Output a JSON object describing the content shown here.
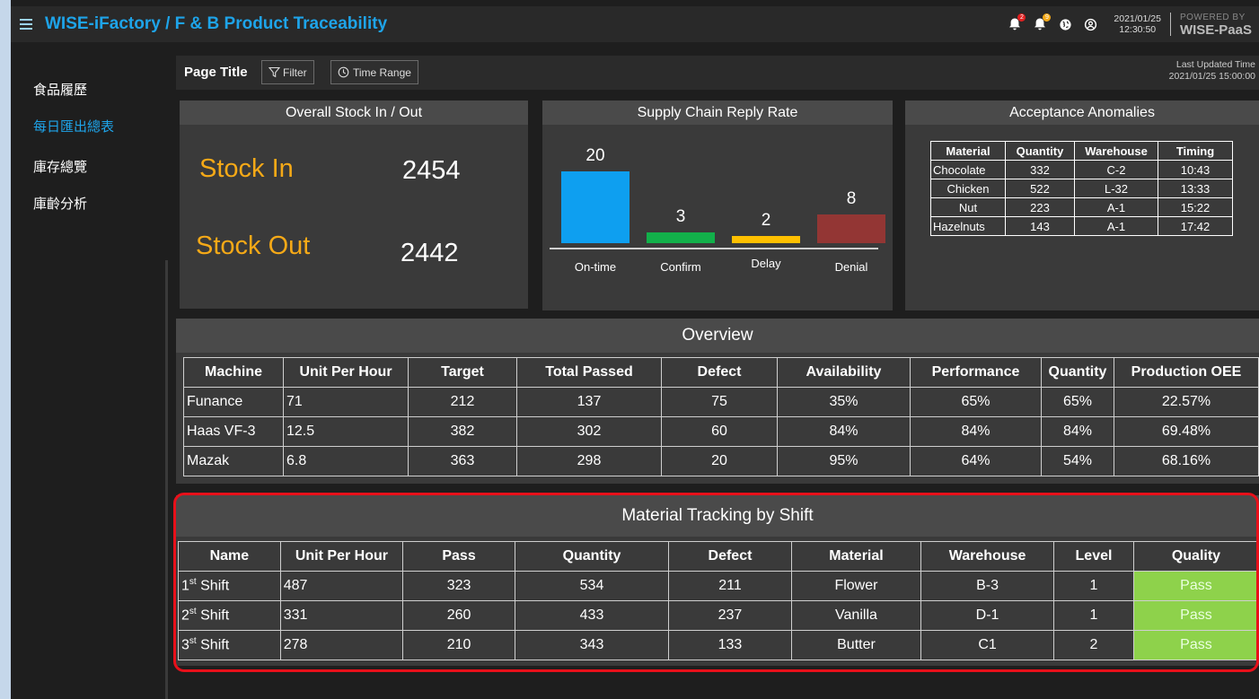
{
  "app": {
    "title": "WISE-iFactory / F & B Product Traceability"
  },
  "header": {
    "notif_badge_1": "2",
    "notif_badge_2": "9",
    "date": "2021/01/25",
    "time": "12:30:50",
    "powered_by_small": "POWERED BY",
    "powered_by_brand": "WISE-PaaS"
  },
  "sidebar": {
    "items": [
      {
        "label": "食品履歷"
      },
      {
        "label": "每日匯出總表"
      },
      {
        "label": "庫存總覽"
      },
      {
        "label": "庫齡分析"
      }
    ]
  },
  "toolbar": {
    "page_title": "Page Title",
    "filter_label": "Filter",
    "time_range_label": "Time Range",
    "last_updated_label": "Last Updated Time",
    "last_updated_value": "2021/01/25 15:00:00"
  },
  "stock": {
    "title": "Overall Stock In / Out",
    "in_label": "Stock In",
    "in_value": "2454",
    "out_label": "Stock Out",
    "out_value": "2442"
  },
  "chart_data": {
    "type": "bar",
    "title": "Supply Chain Reply Rate",
    "categories": [
      "On-time",
      "Confirm",
      "Delay",
      "Denial"
    ],
    "values": [
      20,
      3,
      2,
      8
    ],
    "colors": [
      "#0e9ff0",
      "#12b04a",
      "#ffc000",
      "#933634"
    ],
    "ylim": [
      0,
      20
    ],
    "grid": false
  },
  "anomalies": {
    "title": "Acceptance Anomalies",
    "headers": [
      "Material",
      "Quantity",
      "Warehouse",
      "Timing"
    ],
    "rows": [
      [
        "Chocolate",
        "332",
        "C-2",
        "10:43"
      ],
      [
        "Chicken",
        "522",
        "L-32",
        "13:33"
      ],
      [
        "Nut",
        "223",
        "A-1",
        "15:22"
      ],
      [
        "Hazelnuts",
        "143",
        "A-1",
        "17:42"
      ]
    ]
  },
  "overview": {
    "title": "Overview",
    "headers": [
      "Machine",
      "Unit Per  Hour",
      "Target",
      "Total Passed",
      "Defect",
      "Availability",
      "Performance",
      "Quantity",
      "Production OEE"
    ],
    "rows": [
      [
        "Funance",
        "71",
        "212",
        "137",
        "75",
        "35%",
        "65%",
        "65%",
        "22.57%"
      ],
      [
        "Haas VF-3",
        "12.5",
        "382",
        "302",
        "60",
        "84%",
        "84%",
        "84%",
        "69.48%"
      ],
      [
        "Mazak",
        "6.8",
        "363",
        "298",
        "20",
        "95%",
        "64%",
        "54%",
        "68.16%"
      ]
    ]
  },
  "tracking": {
    "title": "Material Tracking by Shift",
    "headers": [
      "Name",
      "Unit Per  Hour",
      "Pass",
      "Quantity",
      "Defect",
      "Material",
      "Warehouse",
      "Level",
      "Quality"
    ],
    "rows": [
      {
        "num": "1",
        "sup": "st",
        "rest": " Shift",
        "cells": [
          "487",
          "323",
          "534",
          "211",
          "Flower",
          "B-3",
          "1",
          "Pass"
        ]
      },
      {
        "num": "2",
        "sup": "st",
        "rest": " Shift",
        "cells": [
          "331",
          "260",
          "433",
          "237",
          "Vanilla",
          "D-1",
          "1",
          "Pass"
        ]
      },
      {
        "num": "3",
        "sup": "st",
        "rest": " Shift",
        "cells": [
          "278",
          "210",
          "343",
          "133",
          "Butter",
          "C1",
          "2",
          "Pass"
        ]
      }
    ]
  }
}
